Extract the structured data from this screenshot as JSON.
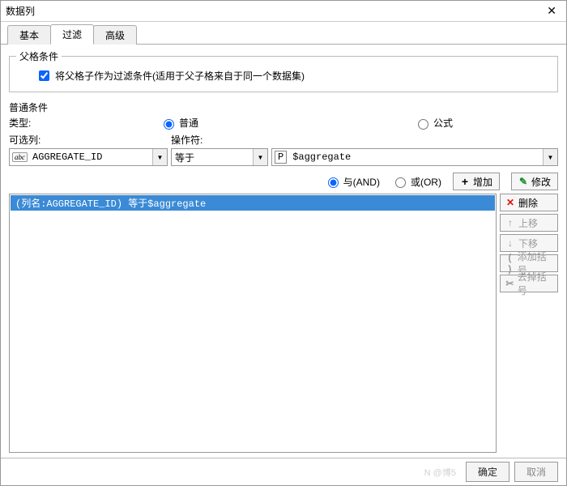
{
  "window": {
    "title": "数据列"
  },
  "tabs": {
    "basic": "基本",
    "filter": "过滤",
    "advanced": "高级"
  },
  "parent": {
    "legend": "父格条件",
    "checkbox_label": "将父格子作为过滤条件(适用于父子格来自于同一个数据集)"
  },
  "normal": {
    "section": "普通条件",
    "type_label": "类型:",
    "radio_normal": "普通",
    "radio_formula": "公式",
    "col_label": "可选列:",
    "op_label": "操作符:",
    "column_value": "AGGREGATE_ID",
    "operator_value": "等于",
    "input_value": "$aggregate"
  },
  "logic": {
    "and": "与(AND)",
    "or": "或(OR)",
    "add": "增加",
    "edit": "修改"
  },
  "list": {
    "item0": "(列名:AGGREGATE_ID) 等于$aggregate"
  },
  "side": {
    "delete": "删除",
    "up": "上移",
    "down": "下移",
    "add_paren": "添加括号",
    "remove_paren": "去掉括号"
  },
  "footer": {
    "watermark": "N @博5",
    "ok": "确定",
    "cancel": "取消"
  }
}
